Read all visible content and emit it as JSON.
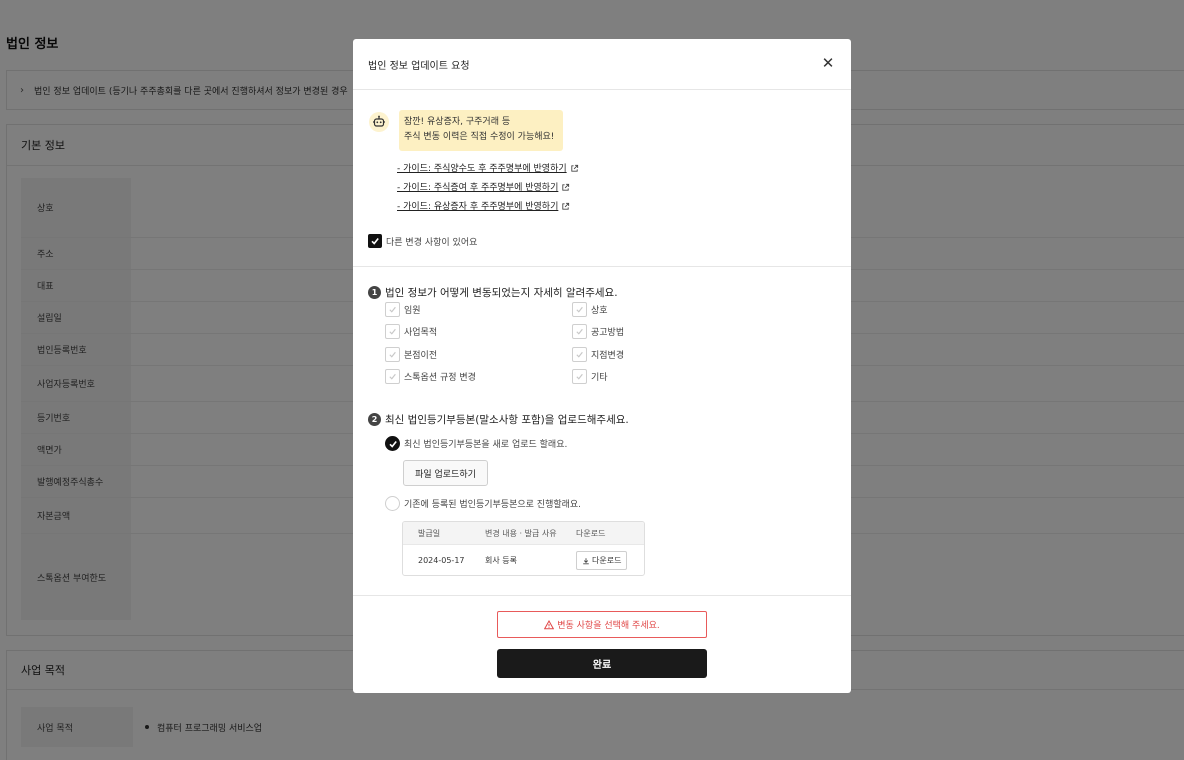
{
  "page": {
    "title": "법인 정보",
    "update_bar": "법인 정보 업데이트 (등기나 주주총회를 다른 곳에서 진행하셔서 정보가 변경된 경우",
    "basic_section_title": "기본 정보",
    "basic_rows": [
      "상호",
      "주소",
      "대표",
      "설립일",
      "법인등록번호",
      "사업자등록번호",
      "등기번호",
      "액면가",
      "발행예정주식총수",
      "자본금액",
      "스톡옵션 부여한도"
    ],
    "purpose_section_title": "사업 목적",
    "purpose_label": "사업 목적",
    "purpose_value": "컴퓨터 프로그래밍 서비스업"
  },
  "modal": {
    "title": "법인 정보 업데이트 요청",
    "notice_line1": "잠깐! 유상증자, 구주거래 등",
    "notice_line2": "주식 변동 이력은 직접 수정이 가능해요!",
    "guides": [
      "- 가이드: 주식양수도 후 주주명부에 반영하기",
      "- 가이드: 주식증여 후 주주명부에 반영하기",
      "- 가이드: 유상증자 후 주주명부에 반영하기"
    ],
    "other_change_label": "다른 변경 사항이 있어요",
    "q1_num": "1",
    "q1_title": "법인 정보가 어떻게 변동되었는지 자세히 알려주세요.",
    "q1_options": [
      "임원",
      "상호",
      "사업목적",
      "공고방법",
      "본점이전",
      "지점변경",
      "스톡옵션 규정 변경",
      "기타"
    ],
    "q2_num": "2",
    "q2_title": "최신 법인등기부등본(말소사항 포함)을 업로드해주세요.",
    "radio_new": "최신 법인등기부등본을 새로 업로드 할래요.",
    "upload_button": "파일 업로드하기",
    "radio_existing": "기존에 등록된 법인등기부등본으로 진행할래요.",
    "table_headers": [
      "발급일",
      "변경 내용 · 발급 사유",
      "다운로드"
    ],
    "table_row": {
      "date": "2024-05-17",
      "reason": "회사 등록",
      "download": "다운로드"
    },
    "warning": "변동 사항을 선택해 주세요.",
    "done_button": "완료"
  },
  "colors": {
    "overlay": "#000000",
    "bubble": "#fdf0c2",
    "warning": "#e04848",
    "primary_button": "#1a1a1a"
  },
  "icons": [
    "chevron-right-icon",
    "close-icon",
    "robot-icon",
    "external-link-icon",
    "check-icon",
    "download-icon",
    "warning-icon"
  ]
}
